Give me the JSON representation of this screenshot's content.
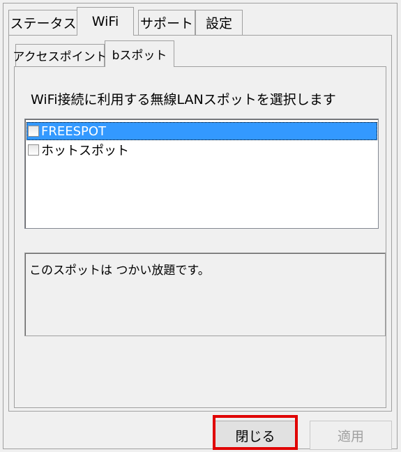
{
  "tabs": [
    {
      "label": "ステータス",
      "active": false
    },
    {
      "label": "WiFi",
      "active": true
    },
    {
      "label": "サポート",
      "active": false
    },
    {
      "label": "設定",
      "active": false
    }
  ],
  "subtabs": [
    {
      "label": "アクセスポイント",
      "active": false
    },
    {
      "label": "bスポット",
      "active": true
    }
  ],
  "description": "WiFi接続に利用する無線LANスポットを選択します",
  "spot_list": [
    {
      "label": "FREESPOT",
      "checked": false,
      "selected": true
    },
    {
      "label": "ホットスポット",
      "checked": false,
      "selected": false
    }
  ],
  "info_text": "このスポットは つかい放題です。",
  "buttons": {
    "close_label": "閉じる",
    "apply_label": "適用",
    "apply_enabled": false
  },
  "colors": {
    "selection": "#3399ff",
    "highlight_frame": "#e00000"
  }
}
